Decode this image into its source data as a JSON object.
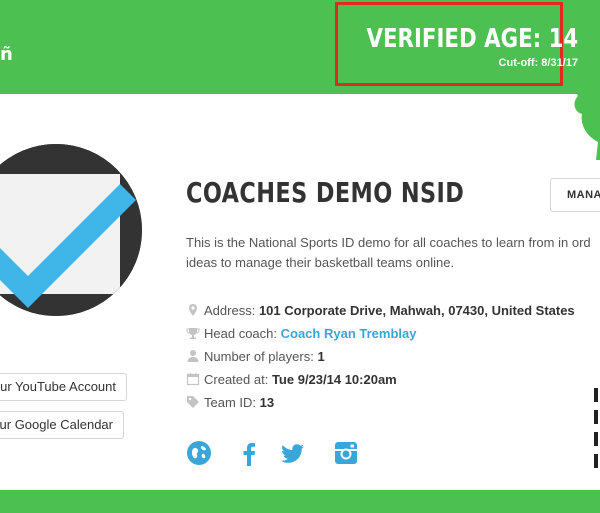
{
  "header": {
    "brand_fragment": "ñ",
    "verified_label": "VERIFIED AGE: 14",
    "cutoff_label": "Cut-off: 8/31/17",
    "colors": {
      "band": "#4cc152",
      "highlight_border": "#e02a1d"
    }
  },
  "profile": {
    "avatar_icon": "checkmark-logo-icon",
    "youtube_button": "our YouTube Account",
    "gcal_button": "our Google Calendar"
  },
  "team": {
    "title": "COACHES DEMO NSID",
    "manage_button": "MANA",
    "description_line1": "This is the National Sports ID demo for all coaches to learn from in ord",
    "description_line2": "ideas to manage their basketball teams online.",
    "info": {
      "address_label": "Address:",
      "address_value": "101 Corporate Drive, Mahwah, 07430, United States",
      "coach_label": "Head coach:",
      "coach_value": "Coach Ryan Tremblay",
      "players_label": "Number of players:",
      "players_value": "1",
      "created_label": "Created at:",
      "created_value": "Tue 9/23/14 10:20am",
      "teamid_label": "Team ID:",
      "teamid_value": "13"
    },
    "social_icons": [
      "globe-icon",
      "facebook-icon",
      "twitter-icon",
      "instagram-icon"
    ],
    "link_color": "#3aa6d8"
  }
}
